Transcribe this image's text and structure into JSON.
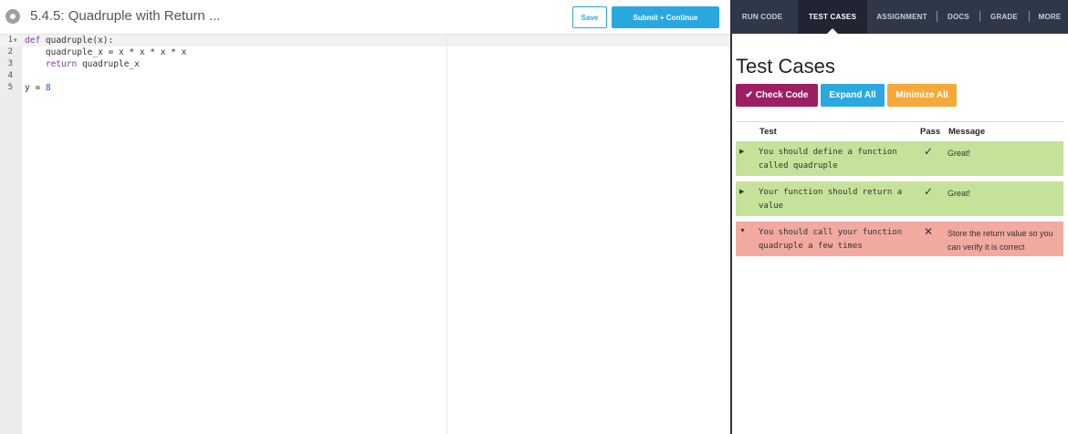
{
  "editor": {
    "title": "5.4.5: Quadruple with Return ...",
    "save_label": "Save",
    "submit_label": "Submit + Continue",
    "lines": [
      {
        "n": "1",
        "code": "def quadruple(x):"
      },
      {
        "n": "2",
        "code": "    quadruple_x = x * x * x * x"
      },
      {
        "n": "3",
        "code": "    return quadruple_x"
      },
      {
        "n": "4",
        "code": ""
      },
      {
        "n": "5",
        "code": "y = 8"
      }
    ]
  },
  "nav": {
    "tabs": [
      {
        "label": "RUN CODE"
      },
      {
        "label": "TEST CASES"
      },
      {
        "label": "ASSIGNMENT"
      },
      {
        "label": "DOCS"
      },
      {
        "label": "GRADE"
      },
      {
        "label": "MORE"
      }
    ],
    "active": "TEST CASES"
  },
  "tests": {
    "title": "Test Cases",
    "check_label": "Check Code",
    "expand_label": "Expand All",
    "minimize_label": "Minimize All",
    "headers": {
      "test": "Test",
      "pass": "Pass",
      "message": "Message"
    },
    "rows": [
      {
        "test": "You should define a function called quadruple",
        "mark": "✓",
        "message": "Great!",
        "status": "pass",
        "arrow": "▶"
      },
      {
        "test": "Your function should return a value",
        "mark": "✓",
        "message": "Great!",
        "status": "pass",
        "arrow": "▶"
      },
      {
        "test": "You should call your function quadruple a few times",
        "mark": "✕",
        "message": "Store the return value so you can verify it is correct",
        "status": "fail",
        "arrow": "▼"
      }
    ]
  },
  "colors": {
    "accent": "#29a8e0",
    "check_button": "#9c1f63",
    "minimize_button": "#f5a93a",
    "pass_row": "#c5e29b",
    "fail_row": "#f1a9a0",
    "nav_bg": "#2f3848"
  },
  "icons": {
    "gear": "gear-icon",
    "check": "checkmark-icon",
    "cross": "cross-icon",
    "expand_arrow": "caret-right-icon",
    "collapse_arrow": "caret-down-icon"
  }
}
